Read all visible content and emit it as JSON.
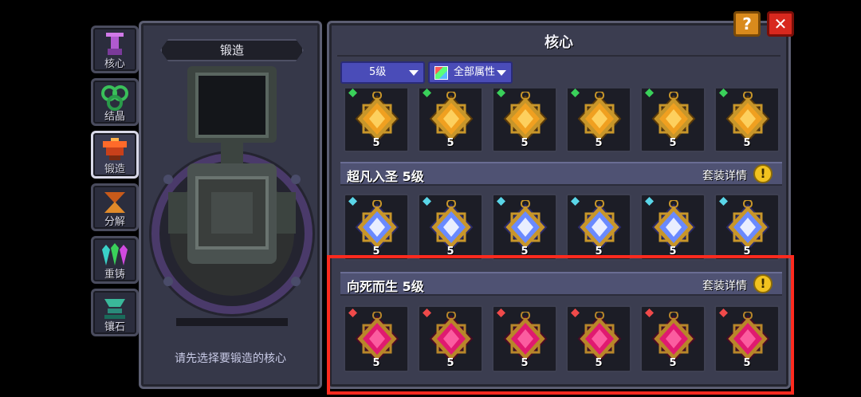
{
  "sidebar": {
    "items": [
      {
        "label": "核心",
        "icon": "core-icon",
        "active": false
      },
      {
        "label": "结晶",
        "icon": "crystal-icon",
        "active": false
      },
      {
        "label": "锻造",
        "icon": "forge-icon",
        "active": true
      },
      {
        "label": "分解",
        "icon": "decompose-icon",
        "active": false
      },
      {
        "label": "重铸",
        "icon": "recast-icon",
        "active": false
      },
      {
        "label": "镶石",
        "icon": "inlay-icon",
        "active": false
      }
    ]
  },
  "forge": {
    "title": "锻造",
    "hint": "请先选择要锻造的核心"
  },
  "core_panel": {
    "title": "核心",
    "level_filter": "5级",
    "attr_filter": "全部属性",
    "top_row": {
      "level_label": "5",
      "gem_color": "#3ad15a",
      "theme": "gold",
      "count": 6
    },
    "sets": [
      {
        "name": "超凡入圣 5级",
        "detail_label": "套装详情",
        "level_label": "5",
        "gem_color": "#5ad6e8",
        "theme": "holy",
        "count": 6
      },
      {
        "name": "向死而生 5级",
        "detail_label": "套装详情",
        "level_label": "5",
        "gem_color": "#f04a4a",
        "theme": "death",
        "count": 6
      }
    ]
  },
  "buttons": {
    "help": "?",
    "close": "✕"
  },
  "colors": {
    "highlight": "#ff2a1e",
    "dropdown": "#4a4cb8",
    "gold_core": "#f0a020",
    "holy_core": "#9ad8ff",
    "death_core": "#e01a70"
  }
}
